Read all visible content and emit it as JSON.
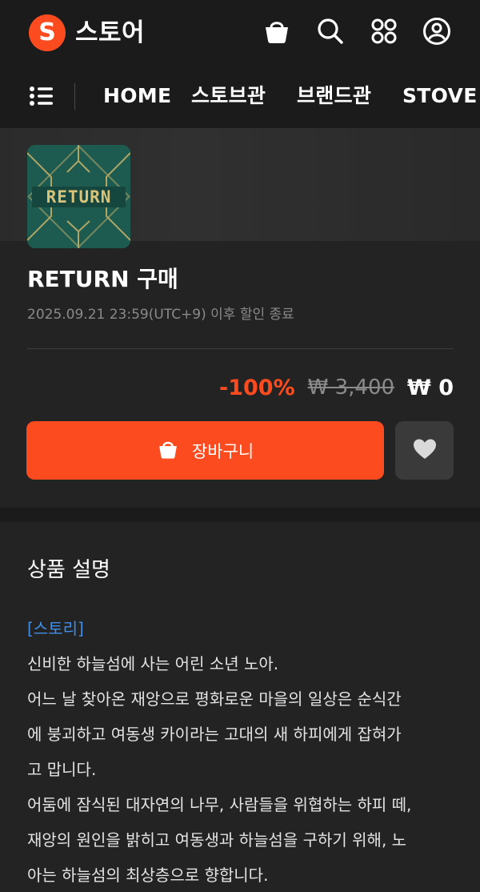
{
  "header": {
    "logo_letter": "S",
    "title": "스토어"
  },
  "nav": {
    "items": [
      "HOME",
      "스토브관",
      "브랜드관",
      "STOVE"
    ]
  },
  "product": {
    "title": "RETURN 구매",
    "sale_note": "2025.09.21 23:59(UTC+9) 이후 할인 종료",
    "thumbnail_text": "RETURN",
    "discount": "-100%",
    "original_price": "₩ 3,400",
    "final_price": "₩ 0",
    "cart_label": "장바구니"
  },
  "description": {
    "title": "상품 설명",
    "story_tag": "[스토리]",
    "lines": [
      "신비한 하늘섬에 사는 어린 소년 노아.",
      "어느 날 찾아온 재앙으로 평화로운 마을의 일상은 순식간",
      "에 붕괴하고 여동생 카이라는 고대의 새 하피에게 잡혀가",
      "고 맙니다.",
      "어둠에 잠식된 대자연의 나무, 사람들을 위협하는 하피 떼,",
      "재앙의 원인을 밝히고 여동생과 하늘섬을 구하기 위해, 노",
      "아는 하늘섬의 최상층으로 향합니다."
    ]
  },
  "colors": {
    "accent": "#fc4c1f",
    "background": "#1b1b1b",
    "panel": "#232323",
    "link": "#3f8ee8"
  }
}
